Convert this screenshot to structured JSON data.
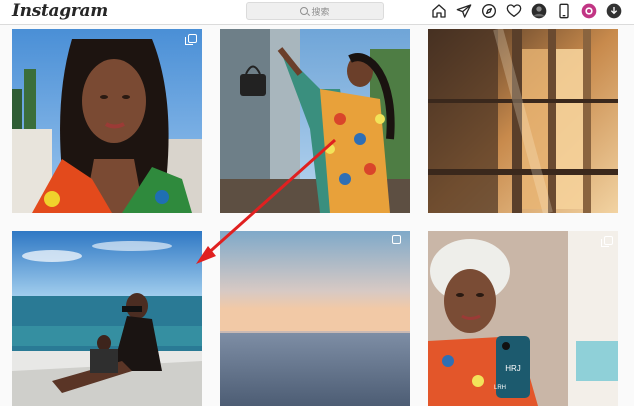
{
  "app": {
    "logo": "Instagram"
  },
  "search": {
    "placeholder": "搜索"
  },
  "nav": {
    "icons": [
      "home-icon",
      "direct-message-icon",
      "explore-icon",
      "activity-heart-icon",
      "profile-avatar-icon",
      "mobile-icon",
      "extension-icon",
      "download-icon"
    ]
  },
  "colors": {
    "accent_arrow": "#e02020",
    "border": "#dbdbdb",
    "text": "#262626"
  },
  "posts": [
    {
      "id": "post-1",
      "multiple": true
    },
    {
      "id": "post-2",
      "multiple": false
    },
    {
      "id": "post-3",
      "multiple": false
    },
    {
      "id": "post-4",
      "multiple": false
    },
    {
      "id": "post-5",
      "multiple": false
    },
    {
      "id": "post-6",
      "multiple": false
    }
  ],
  "phone_case_text": "HRJ",
  "phone_case_text2": "LRH"
}
